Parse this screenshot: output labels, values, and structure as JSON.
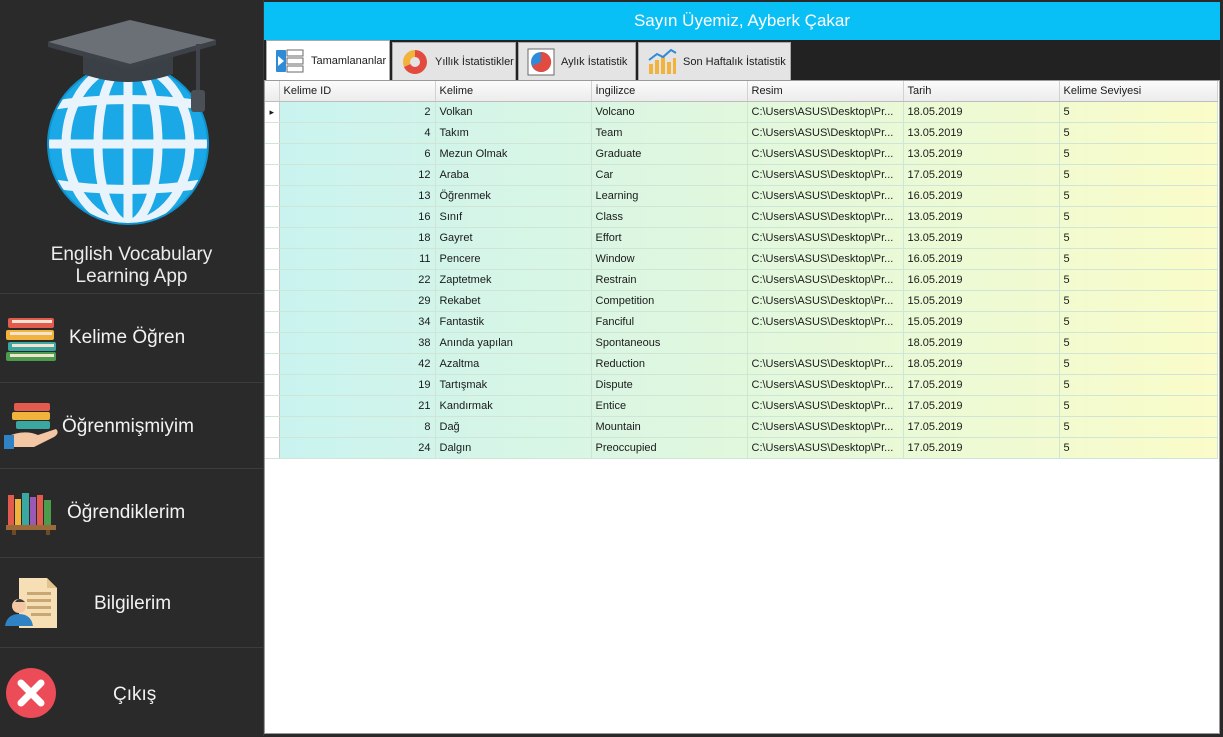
{
  "app_title_line1": "English Vocabulary",
  "app_title_line2": "Learning App",
  "nav": {
    "learn": "Kelime Öğren",
    "test": "Öğrenmişmiyim",
    "learned": "Öğrendiklerim",
    "info": "Bilgilerim",
    "exit": "Çıkış"
  },
  "header_title": "Sayın Üyemiz, Ayberk Çakar",
  "tabs": [
    "Tamamlananlar",
    "Yıllık İstatistikler",
    "Aylık İstatistik",
    "Son Haftalık İstatistik"
  ],
  "table": {
    "columns": [
      "Kelime ID",
      "Kelime",
      "İngilizce",
      "Resim",
      "Tarih",
      "Kelime Seviyesi"
    ],
    "rows": [
      [
        "2",
        "Volkan",
        "Volcano",
        "C:\\Users\\ASUS\\Desktop\\Pr...",
        "18.05.2019",
        "5"
      ],
      [
        "4",
        "Takım",
        "Team",
        "C:\\Users\\ASUS\\Desktop\\Pr...",
        "13.05.2019",
        "5"
      ],
      [
        "6",
        "Mezun Olmak",
        "Graduate",
        "C:\\Users\\ASUS\\Desktop\\Pr...",
        "13.05.2019",
        "5"
      ],
      [
        "12",
        "Araba",
        "Car",
        "C:\\Users\\ASUS\\Desktop\\Pr...",
        "17.05.2019",
        "5"
      ],
      [
        "13",
        "Öğrenmek",
        "Learning",
        "C:\\Users\\ASUS\\Desktop\\Pr...",
        "16.05.2019",
        "5"
      ],
      [
        "16",
        "Sınıf",
        "Class",
        "C:\\Users\\ASUS\\Desktop\\Pr...",
        "13.05.2019",
        "5"
      ],
      [
        "18",
        "Gayret",
        "Effort",
        "C:\\Users\\ASUS\\Desktop\\Pr...",
        "13.05.2019",
        "5"
      ],
      [
        "11",
        "Pencere",
        "Window",
        "C:\\Users\\ASUS\\Desktop\\Pr...",
        "16.05.2019",
        "5"
      ],
      [
        "22",
        "Zaptetmek",
        "Restrain",
        "C:\\Users\\ASUS\\Desktop\\Pr...",
        "16.05.2019",
        "5"
      ],
      [
        "29",
        "Rekabet",
        "Competition",
        "C:\\Users\\ASUS\\Desktop\\Pr...",
        "15.05.2019",
        "5"
      ],
      [
        "34",
        "Fantastik",
        "Fanciful",
        "C:\\Users\\ASUS\\Desktop\\Pr...",
        "15.05.2019",
        "5"
      ],
      [
        "38",
        "Anında yapılan",
        "Spontaneous",
        "",
        "18.05.2019",
        "5"
      ],
      [
        "42",
        "Azaltma",
        "Reduction",
        "C:\\Users\\ASUS\\Desktop\\Pr...",
        "18.05.2019",
        "5"
      ],
      [
        "19",
        "Tartışmak",
        "Dispute",
        "C:\\Users\\ASUS\\Desktop\\Pr...",
        "17.05.2019",
        "5"
      ],
      [
        "21",
        "Kandırmak",
        "Entice",
        "C:\\Users\\ASUS\\Desktop\\Pr...",
        "17.05.2019",
        "5"
      ],
      [
        "8",
        "Dağ",
        "Mountain",
        "C:\\Users\\ASUS\\Desktop\\Pr...",
        "17.05.2019",
        "5"
      ],
      [
        "24",
        "Dalgın",
        "Preoccupied",
        "C:\\Users\\ASUS\\Desktop\\Pr...",
        "17.05.2019",
        "5"
      ]
    ]
  },
  "colors": {
    "header": "#08bff6",
    "sidebar": "#2b2a2a",
    "gradient_start": "#c9f3f1",
    "gradient_end": "#fafcc9"
  }
}
